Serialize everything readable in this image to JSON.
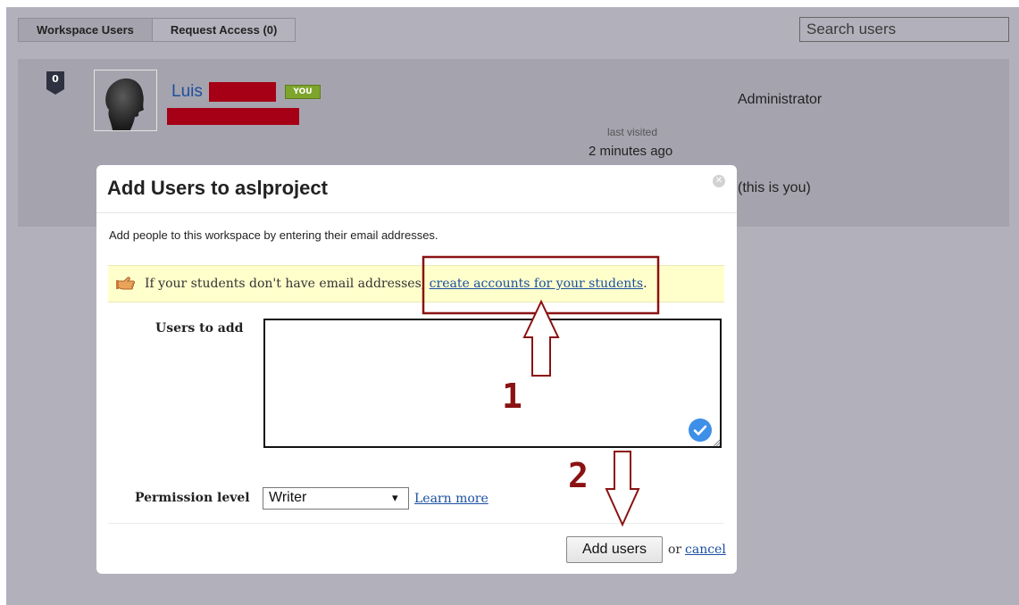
{
  "tabs": [
    {
      "label": "Workspace Users",
      "active": true
    },
    {
      "label": "Request Access (0)",
      "active": false
    }
  ],
  "search": {
    "placeholder": "Search users"
  },
  "user": {
    "badge": "0",
    "name": "Luis",
    "you_tag": "YOU",
    "last_visited_label": "last visited",
    "last_visited_value": "2 minutes ago",
    "role": "Administrator",
    "self_note": "(this is you)",
    "redaction_color": "#a50016"
  },
  "dialog": {
    "title": "Add Users to aslproject",
    "close_icon": "close-icon",
    "description": "Add people to this workspace by entering their email addresses.",
    "notice": {
      "icon": "hand-pointing-icon",
      "text_before": "If your students don't have email addresses, ",
      "link": "create accounts for your students",
      "text_after": "."
    },
    "users_label": "Users to add",
    "users_value": "",
    "permission_label": "Permission level",
    "permission_value": "Writer",
    "learn_more": "Learn more",
    "add_button": "Add users",
    "or_text": "or",
    "cancel": "cancel"
  },
  "annotations": {
    "color": "#8a1212",
    "step1": "1",
    "step2": "2"
  }
}
